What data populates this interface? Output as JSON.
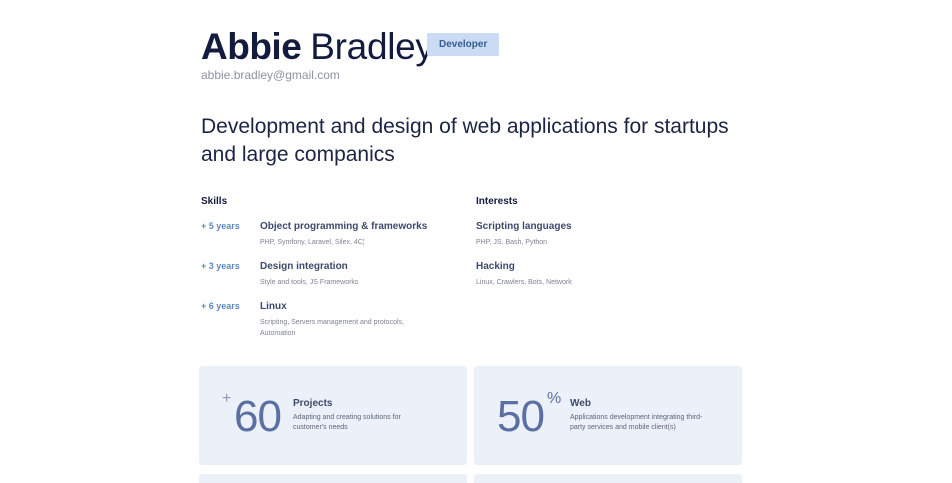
{
  "profile": {
    "first_name": "Abbie",
    "last_name": "Bradley",
    "role": "Developer",
    "email": "abbie.bradley@gmail.com",
    "tagline": "Development and design of web applications for startups and large companics"
  },
  "skills": {
    "title": "Skills",
    "items": [
      {
        "years": "+ 5 years",
        "title": "Object programming & frameworks",
        "desc": "PHP, Symfony, Laravel, Silex, 4C¦"
      },
      {
        "years": "+ 3 years",
        "title": "Design integration",
        "desc": "Style and tools, JS Frameworks"
      },
      {
        "years": "+ 6 years",
        "title": "Linux",
        "desc": "Scripting, Servers management and protocols, Automation"
      }
    ]
  },
  "interests": {
    "title": "Interests",
    "items": [
      {
        "title": "Scripting languages",
        "desc": "PHP, JS, Bash, Python"
      },
      {
        "title": "Hacking",
        "desc": "Linux, Crawlers, Bots, Network"
      }
    ]
  },
  "stats": [
    {
      "prefix": "+",
      "number": "60",
      "suffix": "",
      "title": "Projects",
      "desc": "Adapting and creating solutions for customer's needs"
    },
    {
      "prefix": "",
      "number": "50",
      "suffix": "%",
      "title": "Web",
      "desc": "Applications development integrating third-party services and mobile client(s)"
    }
  ],
  "colors": {
    "accent": "#5b88c4",
    "badge_bg": "#c9dcf3",
    "card_bg": "#ecf0f8",
    "heading": "#131b3f"
  }
}
